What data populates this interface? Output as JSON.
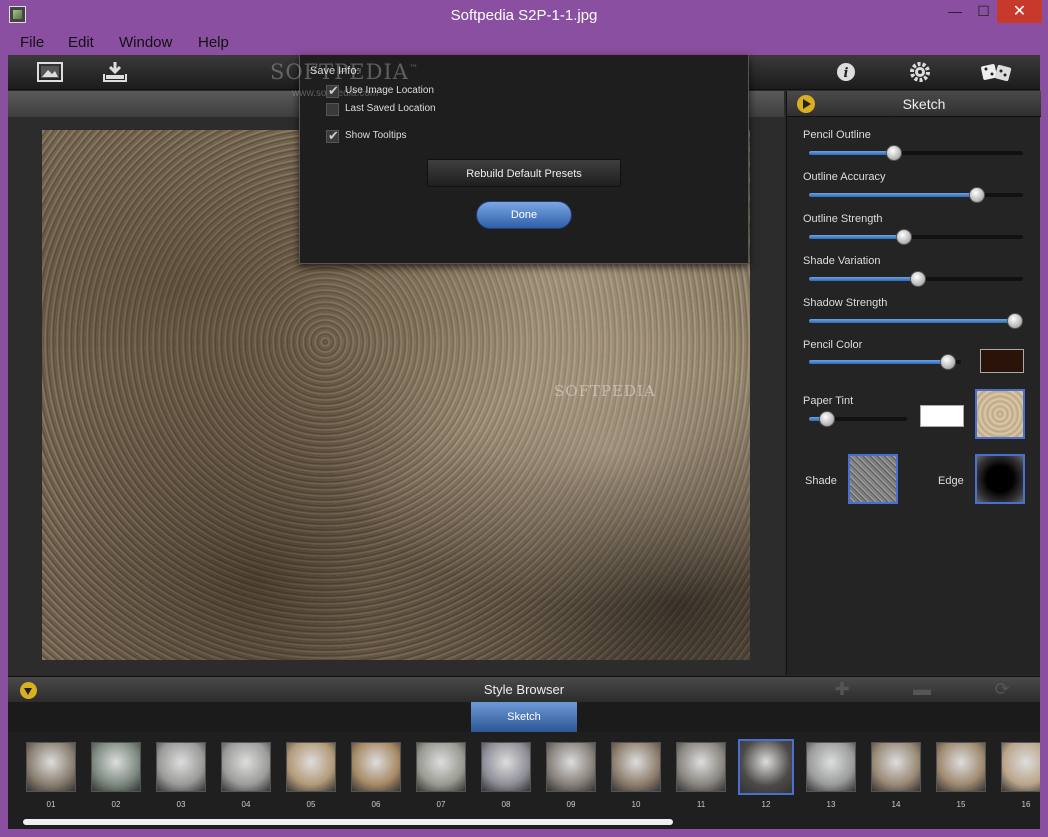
{
  "window": {
    "title": "Softpedia S2P-1-1.jpg",
    "controls": {
      "minimize": "—",
      "maximize": "☐",
      "close": "✕"
    }
  },
  "menu": [
    "File",
    "Edit",
    "Window",
    "Help"
  ],
  "toolbar": {
    "left_icons": [
      "image-icon",
      "download-tray-icon"
    ],
    "right_icons": [
      "info-icon",
      "settings-icon",
      "dice-icon"
    ]
  },
  "dialog": {
    "watermark": "SOFTPEDIA",
    "watermark_tm": "™",
    "watermark_url": "www.softpedia.com",
    "save_info_label": "Save Info:",
    "options": [
      {
        "label": "Use Image Location",
        "checked": true
      },
      {
        "label": "Last Saved Location",
        "checked": false
      },
      {
        "label": "Show Tooltips",
        "checked": true
      }
    ],
    "rebuild_label": "Rebuild Default Presets",
    "done_label": "Done"
  },
  "photo_watermark": "SOFTPEDIA",
  "right_panel": {
    "title": "Sketch",
    "sliders": [
      {
        "label": "Pencil Outline",
        "value": 0.39
      },
      {
        "label": "Outline Accuracy",
        "value": 0.81
      },
      {
        "label": "Outline Strength",
        "value": 0.44
      },
      {
        "label": "Shade Variation",
        "value": 0.51
      },
      {
        "label": "Shadow Strength",
        "value": 1.0
      },
      {
        "label": "Pencil Color",
        "value": 0.96
      },
      {
        "label": "Paper Tint",
        "value": 0.12
      }
    ],
    "pencil_color": "#2a140a",
    "paper_tint_color": "#ffffff",
    "shade_label": "Shade",
    "edge_label": "Edge"
  },
  "style_browser": {
    "title": "Style Browser",
    "tab_label": "Sketch",
    "controls": [
      "add-icon",
      "remove-icon",
      "refresh-icon"
    ],
    "thumbnails": [
      "01",
      "02",
      "03",
      "04",
      "05",
      "06",
      "07",
      "08",
      "09",
      "10",
      "11",
      "12",
      "13",
      "14",
      "15",
      "16"
    ],
    "selected": "12"
  },
  "colors": {
    "window_frame": "#8a4fa0",
    "close_button": "#c7392a",
    "accent_blue": "#2f6bb8",
    "accent_yellow": "#d8b020"
  }
}
